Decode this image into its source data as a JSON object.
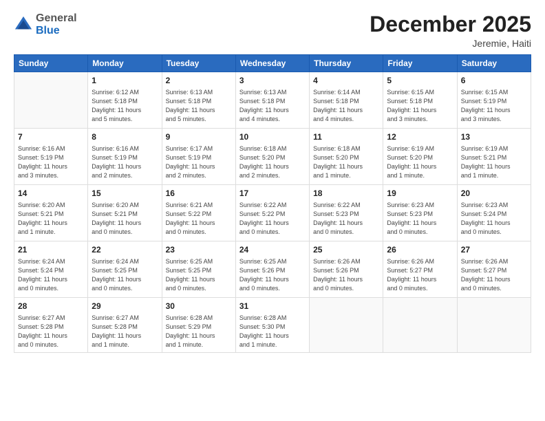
{
  "header": {
    "logo_general": "General",
    "logo_blue": "Blue",
    "month_title": "December 2025",
    "location": "Jeremie, Haiti"
  },
  "days_of_week": [
    "Sunday",
    "Monday",
    "Tuesday",
    "Wednesday",
    "Thursday",
    "Friday",
    "Saturday"
  ],
  "weeks": [
    [
      {
        "day": "",
        "info": ""
      },
      {
        "day": "1",
        "info": "Sunrise: 6:12 AM\nSunset: 5:18 PM\nDaylight: 11 hours\nand 5 minutes."
      },
      {
        "day": "2",
        "info": "Sunrise: 6:13 AM\nSunset: 5:18 PM\nDaylight: 11 hours\nand 5 minutes."
      },
      {
        "day": "3",
        "info": "Sunrise: 6:13 AM\nSunset: 5:18 PM\nDaylight: 11 hours\nand 4 minutes."
      },
      {
        "day": "4",
        "info": "Sunrise: 6:14 AM\nSunset: 5:18 PM\nDaylight: 11 hours\nand 4 minutes."
      },
      {
        "day": "5",
        "info": "Sunrise: 6:15 AM\nSunset: 5:18 PM\nDaylight: 11 hours\nand 3 minutes."
      },
      {
        "day": "6",
        "info": "Sunrise: 6:15 AM\nSunset: 5:19 PM\nDaylight: 11 hours\nand 3 minutes."
      }
    ],
    [
      {
        "day": "7",
        "info": "Sunrise: 6:16 AM\nSunset: 5:19 PM\nDaylight: 11 hours\nand 3 minutes."
      },
      {
        "day": "8",
        "info": "Sunrise: 6:16 AM\nSunset: 5:19 PM\nDaylight: 11 hours\nand 2 minutes."
      },
      {
        "day": "9",
        "info": "Sunrise: 6:17 AM\nSunset: 5:19 PM\nDaylight: 11 hours\nand 2 minutes."
      },
      {
        "day": "10",
        "info": "Sunrise: 6:18 AM\nSunset: 5:20 PM\nDaylight: 11 hours\nand 2 minutes."
      },
      {
        "day": "11",
        "info": "Sunrise: 6:18 AM\nSunset: 5:20 PM\nDaylight: 11 hours\nand 1 minute."
      },
      {
        "day": "12",
        "info": "Sunrise: 6:19 AM\nSunset: 5:20 PM\nDaylight: 11 hours\nand 1 minute."
      },
      {
        "day": "13",
        "info": "Sunrise: 6:19 AM\nSunset: 5:21 PM\nDaylight: 11 hours\nand 1 minute."
      }
    ],
    [
      {
        "day": "14",
        "info": "Sunrise: 6:20 AM\nSunset: 5:21 PM\nDaylight: 11 hours\nand 1 minute."
      },
      {
        "day": "15",
        "info": "Sunrise: 6:20 AM\nSunset: 5:21 PM\nDaylight: 11 hours\nand 0 minutes."
      },
      {
        "day": "16",
        "info": "Sunrise: 6:21 AM\nSunset: 5:22 PM\nDaylight: 11 hours\nand 0 minutes."
      },
      {
        "day": "17",
        "info": "Sunrise: 6:22 AM\nSunset: 5:22 PM\nDaylight: 11 hours\nand 0 minutes."
      },
      {
        "day": "18",
        "info": "Sunrise: 6:22 AM\nSunset: 5:23 PM\nDaylight: 11 hours\nand 0 minutes."
      },
      {
        "day": "19",
        "info": "Sunrise: 6:23 AM\nSunset: 5:23 PM\nDaylight: 11 hours\nand 0 minutes."
      },
      {
        "day": "20",
        "info": "Sunrise: 6:23 AM\nSunset: 5:24 PM\nDaylight: 11 hours\nand 0 minutes."
      }
    ],
    [
      {
        "day": "21",
        "info": "Sunrise: 6:24 AM\nSunset: 5:24 PM\nDaylight: 11 hours\nand 0 minutes."
      },
      {
        "day": "22",
        "info": "Sunrise: 6:24 AM\nSunset: 5:25 PM\nDaylight: 11 hours\nand 0 minutes."
      },
      {
        "day": "23",
        "info": "Sunrise: 6:25 AM\nSunset: 5:25 PM\nDaylight: 11 hours\nand 0 minutes."
      },
      {
        "day": "24",
        "info": "Sunrise: 6:25 AM\nSunset: 5:26 PM\nDaylight: 11 hours\nand 0 minutes."
      },
      {
        "day": "25",
        "info": "Sunrise: 6:26 AM\nSunset: 5:26 PM\nDaylight: 11 hours\nand 0 minutes."
      },
      {
        "day": "26",
        "info": "Sunrise: 6:26 AM\nSunset: 5:27 PM\nDaylight: 11 hours\nand 0 minutes."
      },
      {
        "day": "27",
        "info": "Sunrise: 6:26 AM\nSunset: 5:27 PM\nDaylight: 11 hours\nand 0 minutes."
      }
    ],
    [
      {
        "day": "28",
        "info": "Sunrise: 6:27 AM\nSunset: 5:28 PM\nDaylight: 11 hours\nand 0 minutes."
      },
      {
        "day": "29",
        "info": "Sunrise: 6:27 AM\nSunset: 5:28 PM\nDaylight: 11 hours\nand 1 minute."
      },
      {
        "day": "30",
        "info": "Sunrise: 6:28 AM\nSunset: 5:29 PM\nDaylight: 11 hours\nand 1 minute."
      },
      {
        "day": "31",
        "info": "Sunrise: 6:28 AM\nSunset: 5:30 PM\nDaylight: 11 hours\nand 1 minute."
      },
      {
        "day": "",
        "info": ""
      },
      {
        "day": "",
        "info": ""
      },
      {
        "day": "",
        "info": ""
      }
    ]
  ]
}
